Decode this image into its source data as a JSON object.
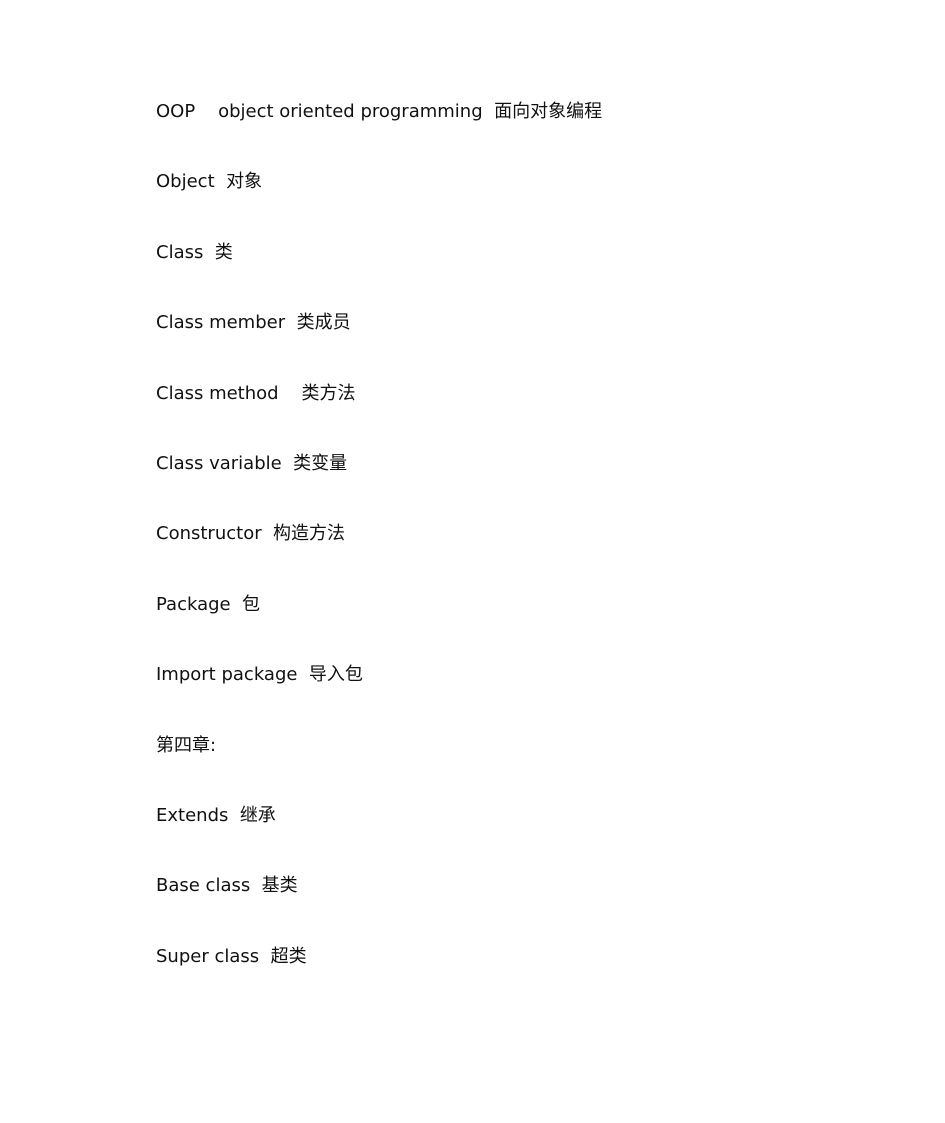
{
  "document": {
    "lines": [
      "OOP    object oriented programming  面向对象编程",
      "Object  对象",
      "Class  类",
      "Class member  类成员",
      "Class method    类方法",
      "Class variable  类变量",
      "Constructor  构造方法",
      "Package  包",
      "Import package  导入包",
      "第四章:",
      "Extends  继承",
      "Base class  基类",
      "Super class  超类"
    ]
  }
}
